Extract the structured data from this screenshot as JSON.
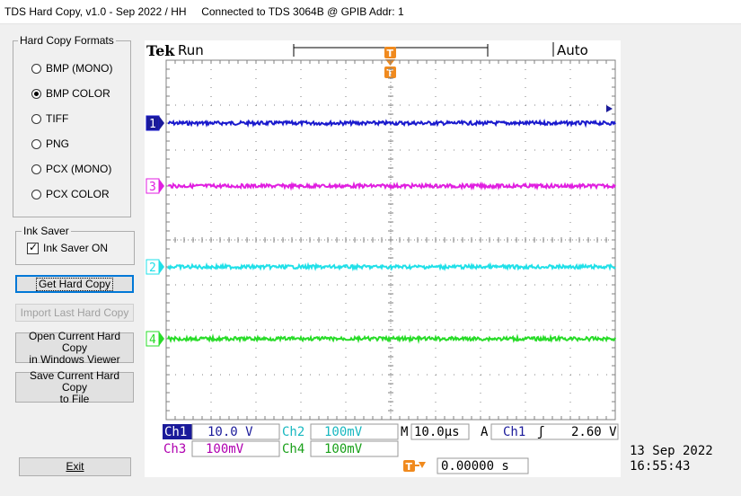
{
  "window": {
    "title": "TDS Hard Copy, v1.0 - Sep 2022 / HH     Connected to TDS 3064B @ GPIB Addr: 1"
  },
  "formats": {
    "legend": "Hard Copy Formats",
    "options": [
      {
        "label": "BMP (MONO)",
        "checked": false
      },
      {
        "label": "BMP COLOR",
        "checked": true
      },
      {
        "label": "TIFF",
        "checked": false
      },
      {
        "label": "PNG",
        "checked": false
      },
      {
        "label": "PCX (MONO)",
        "checked": false
      },
      {
        "label": "PCX COLOR",
        "checked": false
      }
    ]
  },
  "ink_saver": {
    "legend": "Ink Saver",
    "checkbox_label": "Ink Saver ON",
    "checked": true
  },
  "buttons": {
    "get_hard_copy": "Get Hard Copy",
    "import_last": "Import Last Hard Copy",
    "open_current_1": "Open Current Hard Copy",
    "open_current_2": "in Windows Viewer",
    "save_current_1": "Save Current Hard Copy",
    "save_current_2": "to File",
    "exit": "Exit"
  },
  "scope": {
    "brand": "Tek",
    "run_state": "Run",
    "trigger_mode": "Auto",
    "trigger_marker": "T",
    "channels": [
      {
        "id": "1",
        "color": "#1a1acd",
        "level": 0.175,
        "label": "Ch1",
        "scale": "10.0 V"
      },
      {
        "id": "3",
        "color": "#e01ee0",
        "level": 0.35,
        "label": "Ch3",
        "scale": "100mV"
      },
      {
        "id": "2",
        "color": "#20e0e8",
        "level": 0.575,
        "label": "Ch2",
        "scale": "100mV"
      },
      {
        "id": "4",
        "color": "#28dc28",
        "level": 0.775,
        "label": "Ch4",
        "scale": "100mV"
      }
    ],
    "timebase_prefix": "M",
    "timebase": "10.0µs",
    "trigger_prefix": "A",
    "trigger_channel": "Ch1",
    "trigger_slope": "ʃ",
    "trigger_level": "2.60 V",
    "trigger_position": "0.00000 s",
    "date": "13 Sep  2022",
    "time": "16:55:43",
    "colors": {
      "grid": "#808080",
      "orange": "#f08a1e",
      "ch1_box": "#1a1a9a",
      "ch3_text": "#b000b0",
      "ch2_text": "#18b8c0",
      "ch4_text": "#1aa01a"
    }
  }
}
